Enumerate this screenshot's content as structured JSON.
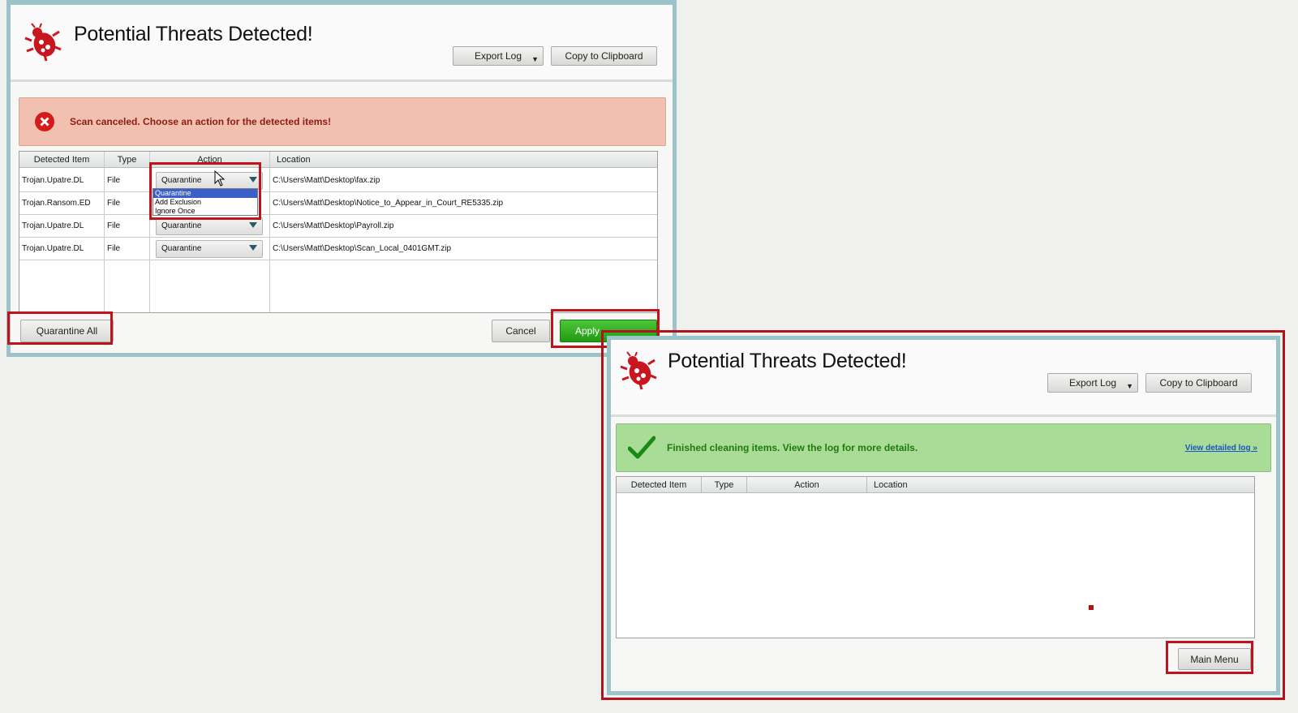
{
  "top_window": {
    "title": "Potential Threats Detected!",
    "export_log": "Export Log",
    "copy_clipboard": "Copy to Clipboard",
    "banner": "Scan canceled. Choose an action for the detected items!",
    "columns": [
      "Detected Item",
      "Type",
      "Action",
      "Location"
    ],
    "rows": [
      {
        "item": "Trojan.Upatre.DL",
        "type": "File",
        "action": "Quarantine",
        "location": "C:\\Users\\Matt\\Desktop\\fax.zip"
      },
      {
        "item": "Trojan.Ransom.ED",
        "type": "File",
        "action": "Quarantine",
        "location": "C:\\Users\\Matt\\Desktop\\Notice_to_Appear_in_Court_RE5335.zip"
      },
      {
        "item": "Trojan.Upatre.DL",
        "type": "File",
        "action": "Quarantine",
        "location": "C:\\Users\\Matt\\Desktop\\Payroll.zip"
      },
      {
        "item": "Trojan.Upatre.DL",
        "type": "File",
        "action": "Quarantine",
        "location": "C:\\Users\\Matt\\Desktop\\Scan_Local_0401GMT.zip"
      }
    ],
    "dropdown_options": [
      "Quarantine",
      "Add Exclusion",
      "Ignore Once"
    ],
    "quarantine_all": "Quarantine All",
    "cancel": "Cancel",
    "apply": "Apply"
  },
  "bottom_window": {
    "title": "Potential Threats Detected!",
    "export_log": "Export Log",
    "copy_clipboard": "Copy to Clipboard",
    "banner": "Finished cleaning items. View the log for more details.",
    "view_log_link": "View detailed log »",
    "columns": [
      "Detected Item",
      "Type",
      "Action",
      "Location"
    ],
    "main_menu": "Main Menu"
  },
  "colors": {
    "highlight_red": "#c0141c",
    "error_banner": "#f2c0b0",
    "success_banner": "#a9dc97",
    "apply_green": "#2ea81e"
  },
  "icons": [
    "bug-icon",
    "error-x-icon",
    "checkmark-icon",
    "dropdown-arrow-icon",
    "mouse-cursor-icon"
  ]
}
